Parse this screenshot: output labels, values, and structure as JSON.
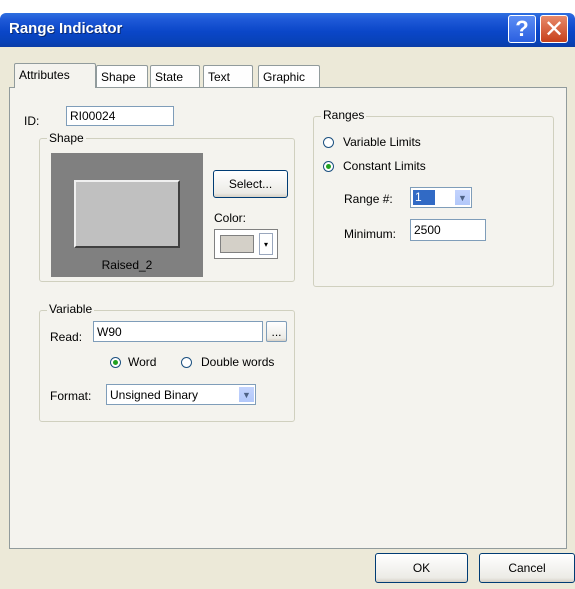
{
  "window": {
    "title": "Range Indicator",
    "help_glyph": "?",
    "close_glyph": "✕"
  },
  "tabs": [
    {
      "label": "Attributes",
      "active": true
    },
    {
      "label": "Shape"
    },
    {
      "label": "State"
    },
    {
      "label": "Text"
    },
    {
      "label": "Graphic"
    }
  ],
  "attributes": {
    "id_label": "ID:",
    "id_value": "RI00024",
    "shape": {
      "group_label": "Shape",
      "preview_label": "Raised_2",
      "select_button": "Select...",
      "color_label": "Color:",
      "color_value": "#d4d0c8"
    },
    "variable": {
      "group_label": "Variable",
      "read_label": "Read:",
      "read_value": "W90",
      "browse_button": "...",
      "word_label": "Word",
      "double_words_label": "Double words",
      "word_selected": true,
      "format_label": "Format:",
      "format_value": "Unsigned Binary"
    },
    "ranges": {
      "group_label": "Ranges",
      "variable_limits_label": "Variable Limits",
      "constant_limits_label": "Constant Limits",
      "constant_selected": true,
      "range_label": "Range #:",
      "range_value": "1",
      "minimum_label": "Minimum:",
      "minimum_value": "2500"
    }
  },
  "footer": {
    "ok_button": "OK",
    "cancel_button": "Cancel"
  }
}
